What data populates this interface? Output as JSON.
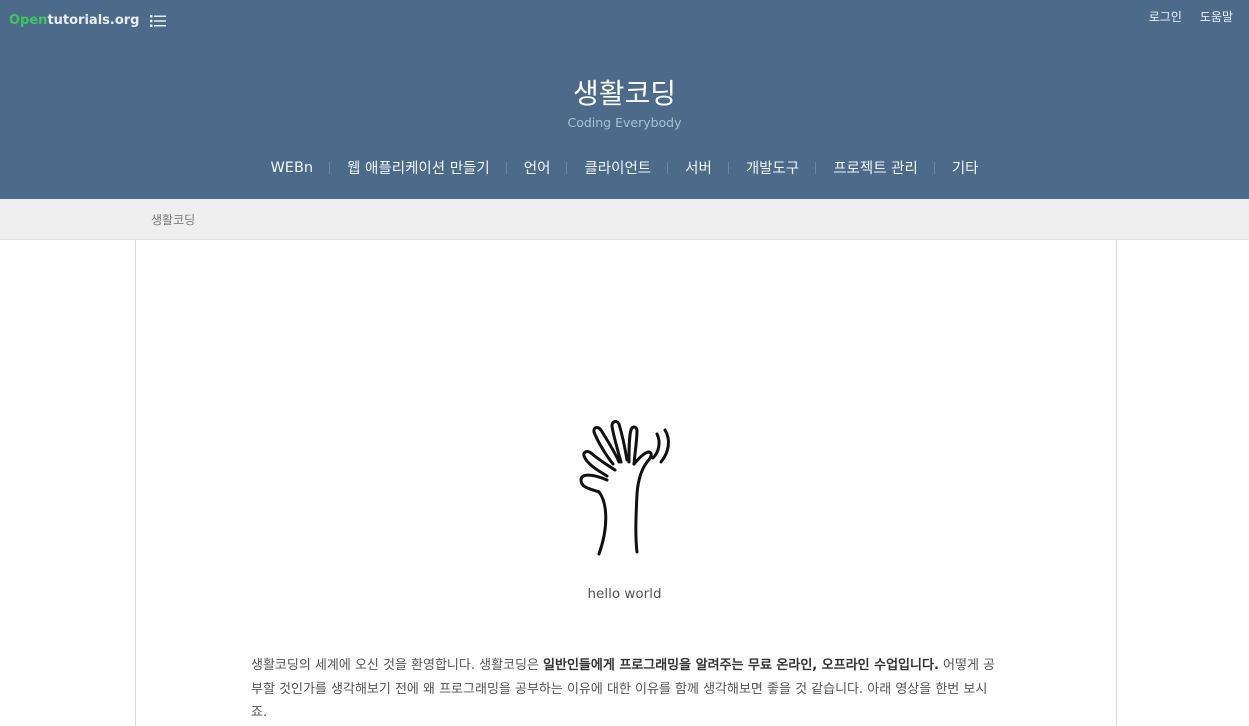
{
  "brand": {
    "open": "Open",
    "rest": "tutorials.org"
  },
  "icons": {
    "menu": "list-menu-icon"
  },
  "top_links": [
    "로그인",
    "도움말"
  ],
  "site": {
    "title": "생활코딩",
    "subtitle": "Coding Everybody"
  },
  "nav": [
    "WEBn",
    "웹 애플리케이션 만들기",
    "언어",
    "클라이언트",
    "서버",
    "개발도구",
    "프로젝트 관리",
    "기타"
  ],
  "breadcrumb": "생활코딩",
  "hero": {
    "icon": "waving-hand-icon",
    "caption": "hello world"
  },
  "intro": {
    "part1": "생활코딩의 세계에 오신 것을 환영합니다. 생활코딩은 ",
    "bold": "일반인들에게 프로그래밍을 알려주는 무료 온라인, 오프라인 수업입니다.",
    "part2": " 어떻게 공부할 것인가를 생각해보기 전에 왜 프로그래밍을 공부하는 이유에 대한 이유를 함께 생각해보면 좋을 것 같습니다. 아래 영상을 한번 보시죠."
  },
  "colors": {
    "header": "#4c6b8b",
    "brand_green": "#3ec760",
    "subtitle": "#a7c0d8",
    "breadcrumb_bg": "#efefef"
  }
}
